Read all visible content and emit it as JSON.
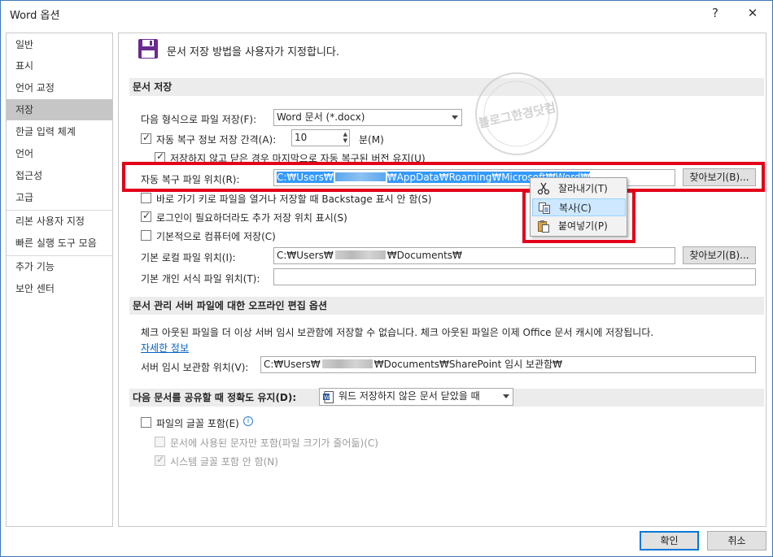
{
  "window": {
    "title": "Word 옵션",
    "help": "?",
    "close": "✕"
  },
  "sidebar": {
    "items": [
      {
        "label": "일반"
      },
      {
        "label": "표시"
      },
      {
        "label": "언어 교정"
      },
      {
        "label": "저장",
        "active": true
      },
      {
        "label": "한글 입력 체계"
      },
      {
        "label": "언어"
      },
      {
        "label": "접근성"
      },
      {
        "label": "고급"
      },
      {
        "label": "리본 사용자 지정"
      },
      {
        "label": "빠른 실행 도구 모음"
      },
      {
        "label": "추가 기능"
      },
      {
        "label": "보안 센터"
      }
    ]
  },
  "header": {
    "icon": "floppy-disk-icon",
    "text": "문서 저장 방법을 사용자가 지정합니다."
  },
  "save_section": {
    "title": "문서 저장",
    "format_label": "다음 형식으로 파일 저장(F):",
    "format_value": "Word 문서 (*.docx)",
    "autorecover_label": "자동 복구 정보 저장 간격(A):",
    "autorecover_minutes": "10",
    "minutes_unit": "분(M)",
    "keep_version_label": "저장하지 않고 닫은 경우 마지막으로 자동 복구된 버전 유지(U)",
    "autorecover_path_label": "자동 복구 파일 위치(R):",
    "autorecover_path_prefix": "C:₩Users₩",
    "autorecover_path_suffix": "₩AppData₩Roaming₩Microsoft₩Word₩",
    "browse1": "찾아보기(B)...",
    "backstage_label": "바로 가기 키로 파일을 열거나 저장할 때 Backstage 표시 안 함(S)",
    "extra_locations_label": "로그인이 필요하더라도 추가 저장 위치 표시(S)",
    "save_to_computer_label": "기본적으로 컴퓨터에 저장(C)",
    "local_path_label": "기본 로컬 파일 위치(I):",
    "local_path_prefix": "C:₩Users₩",
    "local_path_suffix": "₩Documents₩",
    "browse2": "찾아보기(B)...",
    "template_label": "기본 개인 서식 파일 위치(T):",
    "template_value": ""
  },
  "context_menu": {
    "items": [
      {
        "label": "잘라내기(T)",
        "icon": "scissors-icon"
      },
      {
        "label": "복사(C)",
        "icon": "copy-icon"
      },
      {
        "label": "붙여넣기(P)",
        "icon": "paste-icon"
      }
    ]
  },
  "offline_section": {
    "title": "문서 관리 서버 파일에 대한 오프라인 편집 옵션",
    "desc": "체크 아웃된 파일을 더 이상 서버 임시 보관함에 저장할 수 없습니다. 체크 아웃된 파일은 이제 Office 문서 캐시에 저장됩니다.",
    "link": "자세한 정보",
    "drafts_label": "서버 임시 보관함 위치(V):",
    "drafts_prefix": "C:₩Users₩",
    "drafts_suffix": "₩Documents₩SharePoint 임시 보관함₩"
  },
  "fidelity_section": {
    "title": "다음 문서를 공유할 때 정확도 유지(D):",
    "doc_value": "워드 저장하지 않은 문서 닫았을 때",
    "embed_fonts_label": "파일의 글꼴 포함(E)",
    "embed_used_label": "문서에 사용된 문자만 포함(파일 크기가 줄어듦)(C)",
    "no_system_fonts_label": "시스템 글꼴 포함 안 함(N)"
  },
  "footer": {
    "ok": "확인",
    "cancel": "취소"
  },
  "watermark": {
    "text": "블로그한경닷컴"
  },
  "colors": {
    "highlight": "#e2001a",
    "selection": "#3399ff",
    "link": "#0563c1",
    "accent": "#0078d7"
  }
}
